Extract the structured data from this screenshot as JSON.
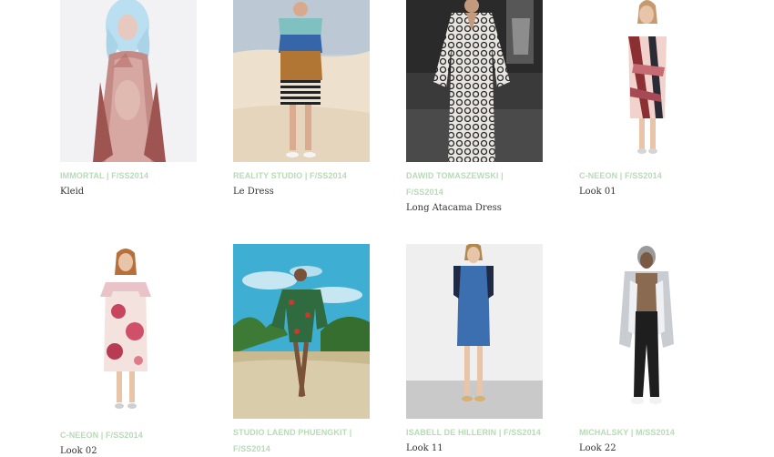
{
  "products": [
    {
      "designer": "IMMORTAL | F/SS2014",
      "name": "Kleid"
    },
    {
      "designer": "REALITY STUDIO | F/SS2014",
      "name": "Le Dress"
    },
    {
      "designer": "DAWID TOMASZEWSKI | F/SS2014",
      "name": "Long Atacama Dress"
    },
    {
      "designer": "C-NEEON | F/SS2014",
      "name": "Look 01"
    },
    {
      "designer": "C-NEEON | F/SS2014",
      "name": "Look 02"
    },
    {
      "designer": "STUDIO LAEND PHUENGKIT | F/SS2014",
      "name": ""
    },
    {
      "designer": "ISABELL DE HILLERIN | F/SS2014",
      "name": "Look 11"
    },
    {
      "designer": "MICHALSKY | M/SS2014",
      "name": "Look 22"
    }
  ],
  "colors": {
    "label": "#b6dbb6",
    "title": "#333333",
    "background": "#ffffff"
  }
}
